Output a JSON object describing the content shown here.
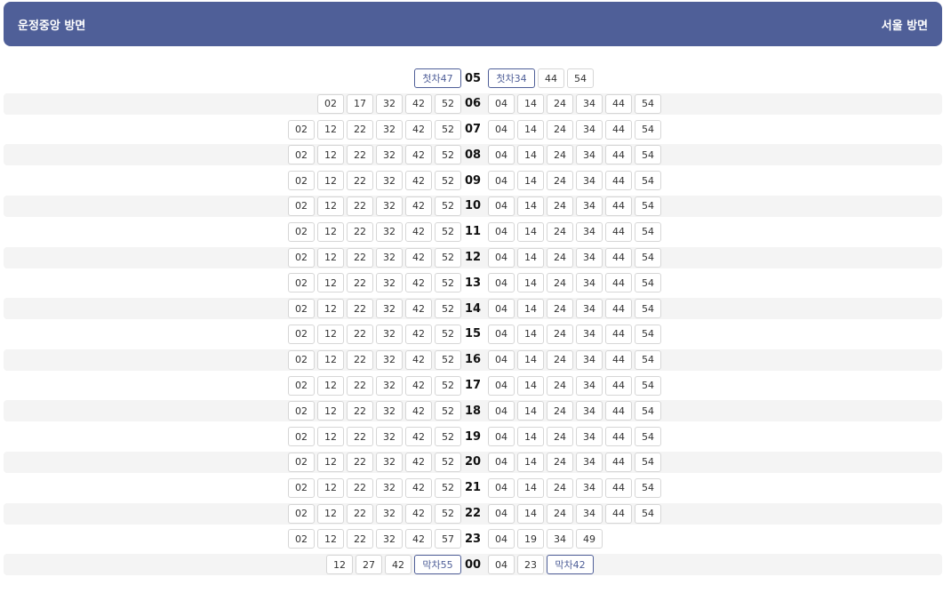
{
  "header": {
    "left_title": "운정중앙 방면",
    "right_title": "서울 방면"
  },
  "rows": [
    {
      "hour": "05",
      "left": [
        "첫차47"
      ],
      "right": [
        "첫차34",
        "44",
        "54"
      ]
    },
    {
      "hour": "06",
      "left": [
        "02",
        "17",
        "32",
        "42",
        "52"
      ],
      "right": [
        "04",
        "14",
        "24",
        "34",
        "44",
        "54"
      ]
    },
    {
      "hour": "07",
      "left": [
        "02",
        "12",
        "22",
        "32",
        "42",
        "52"
      ],
      "right": [
        "04",
        "14",
        "24",
        "34",
        "44",
        "54"
      ]
    },
    {
      "hour": "08",
      "left": [
        "02",
        "12",
        "22",
        "32",
        "42",
        "52"
      ],
      "right": [
        "04",
        "14",
        "24",
        "34",
        "44",
        "54"
      ]
    },
    {
      "hour": "09",
      "left": [
        "02",
        "12",
        "22",
        "32",
        "42",
        "52"
      ],
      "right": [
        "04",
        "14",
        "24",
        "34",
        "44",
        "54"
      ]
    },
    {
      "hour": "10",
      "left": [
        "02",
        "12",
        "22",
        "32",
        "42",
        "52"
      ],
      "right": [
        "04",
        "14",
        "24",
        "34",
        "44",
        "54"
      ]
    },
    {
      "hour": "11",
      "left": [
        "02",
        "12",
        "22",
        "32",
        "42",
        "52"
      ],
      "right": [
        "04",
        "14",
        "24",
        "34",
        "44",
        "54"
      ]
    },
    {
      "hour": "12",
      "left": [
        "02",
        "12",
        "22",
        "32",
        "42",
        "52"
      ],
      "right": [
        "04",
        "14",
        "24",
        "34",
        "44",
        "54"
      ]
    },
    {
      "hour": "13",
      "left": [
        "02",
        "12",
        "22",
        "32",
        "42",
        "52"
      ],
      "right": [
        "04",
        "14",
        "24",
        "34",
        "44",
        "54"
      ]
    },
    {
      "hour": "14",
      "left": [
        "02",
        "12",
        "22",
        "32",
        "42",
        "52"
      ],
      "right": [
        "04",
        "14",
        "24",
        "34",
        "44",
        "54"
      ]
    },
    {
      "hour": "15",
      "left": [
        "02",
        "12",
        "22",
        "32",
        "42",
        "52"
      ],
      "right": [
        "04",
        "14",
        "24",
        "34",
        "44",
        "54"
      ]
    },
    {
      "hour": "16",
      "left": [
        "02",
        "12",
        "22",
        "32",
        "42",
        "52"
      ],
      "right": [
        "04",
        "14",
        "24",
        "34",
        "44",
        "54"
      ]
    },
    {
      "hour": "17",
      "left": [
        "02",
        "12",
        "22",
        "32",
        "42",
        "52"
      ],
      "right": [
        "04",
        "14",
        "24",
        "34",
        "44",
        "54"
      ]
    },
    {
      "hour": "18",
      "left": [
        "02",
        "12",
        "22",
        "32",
        "42",
        "52"
      ],
      "right": [
        "04",
        "14",
        "24",
        "34",
        "44",
        "54"
      ]
    },
    {
      "hour": "19",
      "left": [
        "02",
        "12",
        "22",
        "32",
        "42",
        "52"
      ],
      "right": [
        "04",
        "14",
        "24",
        "34",
        "44",
        "54"
      ]
    },
    {
      "hour": "20",
      "left": [
        "02",
        "12",
        "22",
        "32",
        "42",
        "52"
      ],
      "right": [
        "04",
        "14",
        "24",
        "34",
        "44",
        "54"
      ]
    },
    {
      "hour": "21",
      "left": [
        "02",
        "12",
        "22",
        "32",
        "42",
        "52"
      ],
      "right": [
        "04",
        "14",
        "24",
        "34",
        "44",
        "54"
      ]
    },
    {
      "hour": "22",
      "left": [
        "02",
        "12",
        "22",
        "32",
        "42",
        "52"
      ],
      "right": [
        "04",
        "14",
        "24",
        "34",
        "44",
        "54"
      ]
    },
    {
      "hour": "23",
      "left": [
        "02",
        "12",
        "22",
        "32",
        "42",
        "57"
      ],
      "right": [
        "04",
        "19",
        "34",
        "49"
      ]
    },
    {
      "hour": "00",
      "left": [
        "12",
        "27",
        "42",
        "막차55"
      ],
      "right": [
        "04",
        "23",
        "막차42"
      ]
    }
  ]
}
